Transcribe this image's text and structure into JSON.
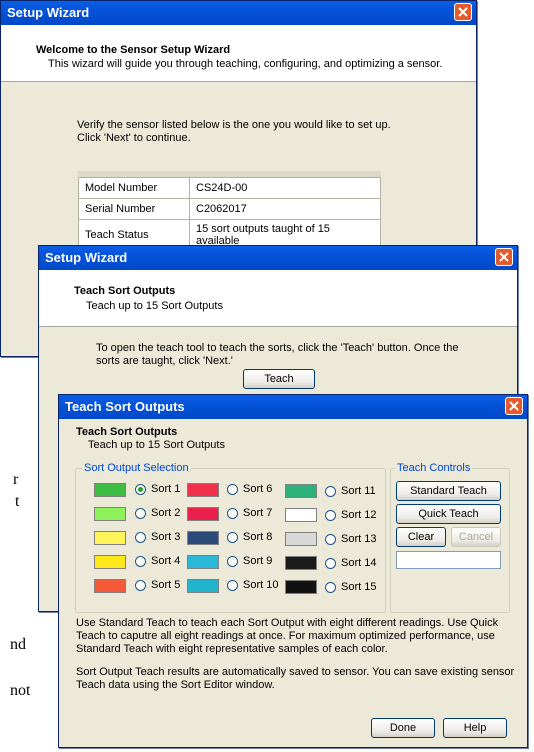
{
  "background_fragments": [
    "r",
    "t",
    "nd",
    "not"
  ],
  "window1": {
    "title": "Setup Wizard",
    "header_title": "Welcome to the Sensor Setup Wizard",
    "header_subtitle": "This wizard will guide you through teaching, configuring, and optimizing a sensor.",
    "instruction_line1": "Verify the sensor listed below is the one you would like to set up.",
    "instruction_line2": "Click 'Next' to continue.",
    "table": [
      {
        "label": "Model Number",
        "value": "CS24D-00"
      },
      {
        "label": "Serial Number",
        "value": "C2062017"
      },
      {
        "label": "Teach Status",
        "value": "15 sort outputs taught of 15 available"
      }
    ]
  },
  "window2": {
    "title": "Setup Wizard",
    "header_title": "Teach Sort Outputs",
    "header_subtitle": "Teach up to 15 Sort Outputs",
    "instruction_line1": "To open the teach tool to teach the sorts, click the 'Teach' button. Once the",
    "instruction_line2": "sorts are taught, click 'Next.'",
    "teach_button": "Teach"
  },
  "window3": {
    "title": "Teach Sort Outputs",
    "header_title": "Teach Sort Outputs",
    "header_subtitle": "Teach up to 15 Sort Outputs",
    "sort_group_label": "Sort Output Selection",
    "sorts": [
      {
        "label": "Sort 1",
        "color": "#3ebd45",
        "selected": true
      },
      {
        "label": "Sort 2",
        "color": "#8ef05a",
        "selected": false
      },
      {
        "label": "Sort 3",
        "color": "#fff45a",
        "selected": false
      },
      {
        "label": "Sort 4",
        "color": "#ffe81a",
        "selected": false
      },
      {
        "label": "Sort 5",
        "color": "#f45a3a",
        "selected": false
      },
      {
        "label": "Sort 6",
        "color": "#f0304a",
        "selected": false
      },
      {
        "label": "Sort 7",
        "color": "#e8204a",
        "selected": false
      },
      {
        "label": "Sort 8",
        "color": "#2c4a7a",
        "selected": false
      },
      {
        "label": "Sort 9",
        "color": "#2ab8d8",
        "selected": false
      },
      {
        "label": "Sort 10",
        "color": "#22b4cc",
        "selected": false
      },
      {
        "label": "Sort 11",
        "color": "#2eb07a",
        "selected": false
      },
      {
        "label": "Sort 12",
        "color": "#ffffff",
        "selected": false
      },
      {
        "label": "Sort 13",
        "color": "#d8d8d8",
        "selected": false
      },
      {
        "label": "Sort 14",
        "color": "#1a1a1a",
        "selected": false
      },
      {
        "label": "Sort 15",
        "color": "#111111",
        "selected": false
      }
    ],
    "teach_controls_label": "Teach Controls",
    "standard_teach": "Standard Teach",
    "quick_teach": "Quick Teach",
    "clear": "Clear",
    "cancel": "Cancel",
    "status_field": "",
    "desc1_line1": "Use Standard Teach to teach each Sort Output with eight different readings. Use Quick",
    "desc1_line2": "Teach to caputre all eight readings at once. For maximum optimized performance, use",
    "desc1_line3": "Standard Teach with eight representative samples of each color.",
    "desc2_line1": "Sort Output Teach results are automatically saved to sensor.  You can save existing sensor",
    "desc2_line2": "Teach data using the Sort Editor window.",
    "done": "Done",
    "help": "Help"
  }
}
